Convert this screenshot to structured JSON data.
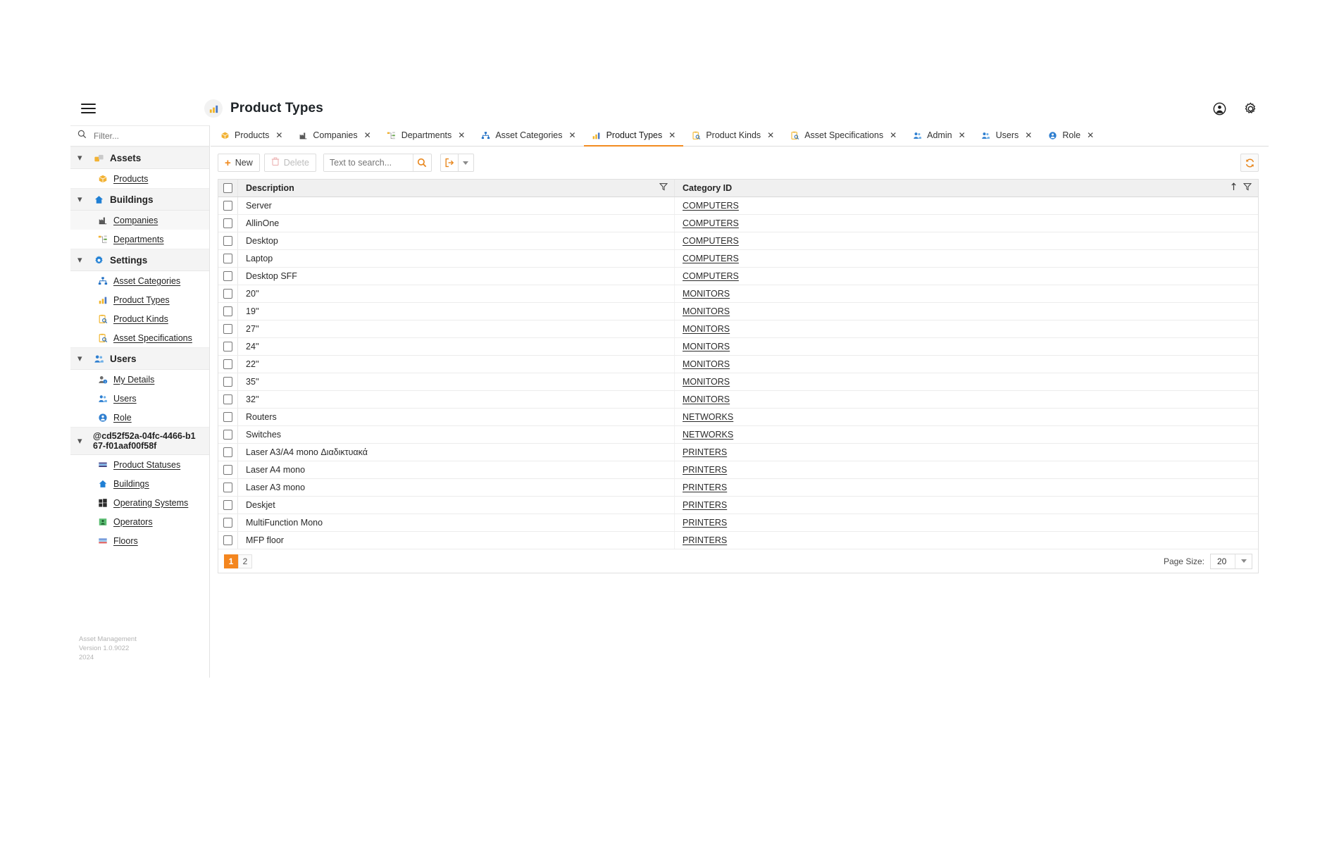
{
  "header": {
    "title": "Product Types",
    "title_icon": "chart-bar-icon",
    "menu_icon": "hamburger-icon",
    "account_icon": "account-circle-icon",
    "settings_icon": "gear-icon"
  },
  "sidebar": {
    "filter_placeholder": "Filter...",
    "search_icon": "search-icon",
    "groups": [
      {
        "label": "Assets",
        "icon": "assets-icon",
        "expanded": true,
        "items": [
          {
            "label": "Products",
            "icon": "box-icon",
            "highlight": false
          }
        ]
      },
      {
        "label": "Buildings",
        "icon": "home-icon",
        "expanded": true,
        "items": [
          {
            "label": "Companies",
            "icon": "factory-icon",
            "highlight": true
          },
          {
            "label": "Departments",
            "icon": "org-tree-icon",
            "highlight": false
          }
        ]
      },
      {
        "label": "Settings",
        "icon": "gear-icon",
        "expanded": true,
        "items": [
          {
            "label": "Asset Categories",
            "icon": "sitemap-icon",
            "highlight": false
          },
          {
            "label": "Product Types",
            "icon": "chart-bar-icon",
            "highlight": false
          },
          {
            "label": "Product Kinds",
            "icon": "clipboard-search-icon",
            "highlight": false
          },
          {
            "label": "Asset Specifications",
            "icon": "clipboard-search-icon",
            "highlight": false
          }
        ]
      },
      {
        "label": "Users",
        "icon": "users-icon",
        "expanded": true,
        "items": [
          {
            "label": "My Details",
            "icon": "user-info-icon",
            "highlight": false
          },
          {
            "label": "Users",
            "icon": "users-icon",
            "highlight": false
          },
          {
            "label": "Role",
            "icon": "role-circle-icon",
            "highlight": false
          }
        ]
      },
      {
        "label": "@cd52f52a-04fc-4466-b167-f01aaf00f58f",
        "icon": "",
        "expanded": true,
        "uuid": true,
        "items": [
          {
            "label": "Product Statuses",
            "icon": "status-bars-icon",
            "highlight": false
          },
          {
            "label": "Buildings",
            "icon": "home-icon",
            "highlight": false
          },
          {
            "label": "Operating Systems",
            "icon": "windows-icon",
            "highlight": false
          },
          {
            "label": "Operators",
            "icon": "operator-icon",
            "highlight": false
          },
          {
            "label": "Floors",
            "icon": "floors-icon",
            "highlight": false
          }
        ]
      }
    ],
    "footer": {
      "app_name": "Asset Management",
      "version": "Version 1.0.9022",
      "year": "2024"
    }
  },
  "tabs": [
    {
      "label": "Products",
      "icon": "box-icon",
      "active": false
    },
    {
      "label": "Companies",
      "icon": "factory-icon",
      "active": false
    },
    {
      "label": "Departments",
      "icon": "org-tree-icon",
      "active": false
    },
    {
      "label": "Asset Categories",
      "icon": "sitemap-icon",
      "active": false
    },
    {
      "label": "Product Types",
      "icon": "chart-bar-icon",
      "active": true
    },
    {
      "label": "Product Kinds",
      "icon": "clipboard-search-icon",
      "active": false
    },
    {
      "label": "Asset Specifications",
      "icon": "clipboard-search-icon",
      "active": false
    },
    {
      "label": "Admin",
      "icon": "users-icon",
      "active": false
    },
    {
      "label": "Users",
      "icon": "users-icon",
      "active": false
    },
    {
      "label": "Role",
      "icon": "role-circle-icon",
      "active": false
    }
  ],
  "toolbar": {
    "new_label": "New",
    "delete_label": "Delete",
    "search_placeholder": "Text to search...",
    "search_value": "",
    "search_icon": "search-icon",
    "export_icon": "export-icon",
    "refresh_icon": "refresh-icon",
    "new_icon": "plus-icon",
    "delete_icon": "trash-icon"
  },
  "grid": {
    "columns": [
      {
        "key": "description",
        "label": "Description",
        "filter_icon": "filter-icon",
        "sorted": false
      },
      {
        "key": "category_id",
        "label": "Category ID",
        "filter_icon": "filter-icon",
        "sorted": true,
        "sort_icon": "sort-asc-icon"
      }
    ],
    "rows": [
      {
        "description": "Server",
        "category_id": "COMPUTERS"
      },
      {
        "description": "AllinOne",
        "category_id": "COMPUTERS"
      },
      {
        "description": "Desktop",
        "category_id": "COMPUTERS"
      },
      {
        "description": "Laptop",
        "category_id": "COMPUTERS"
      },
      {
        "description": "Desktop SFF",
        "category_id": "COMPUTERS"
      },
      {
        "description": "20''",
        "category_id": "MONITORS"
      },
      {
        "description": "19''",
        "category_id": "MONITORS"
      },
      {
        "description": "27''",
        "category_id": "MONITORS"
      },
      {
        "description": "24''",
        "category_id": "MONITORS"
      },
      {
        "description": "22''",
        "category_id": "MONITORS"
      },
      {
        "description": "35''",
        "category_id": "MONITORS"
      },
      {
        "description": "32''",
        "category_id": "MONITORS"
      },
      {
        "description": "Routers",
        "category_id": "NETWORKS"
      },
      {
        "description": "Switches",
        "category_id": "NETWORKS"
      },
      {
        "description": "Laser A3/A4 mono Διαδικτυακά",
        "category_id": "PRINTERS"
      },
      {
        "description": "Laser A4 mono",
        "category_id": "PRINTERS"
      },
      {
        "description": "Laser A3 mono",
        "category_id": "PRINTERS"
      },
      {
        "description": "Deskjet",
        "category_id": "PRINTERS"
      },
      {
        "description": "MultiFunction Mono",
        "category_id": "PRINTERS"
      },
      {
        "description": "MFP floor",
        "category_id": "PRINTERS"
      }
    ]
  },
  "pager": {
    "pages": [
      {
        "label": "1",
        "active": true
      },
      {
        "label": "2",
        "active": false
      }
    ],
    "page_size_label": "Page Size:",
    "page_size_value": "20"
  },
  "colors": {
    "accent": "#f4861f",
    "link": "#2a2a2a",
    "header_bg": "#f0f0f0"
  }
}
